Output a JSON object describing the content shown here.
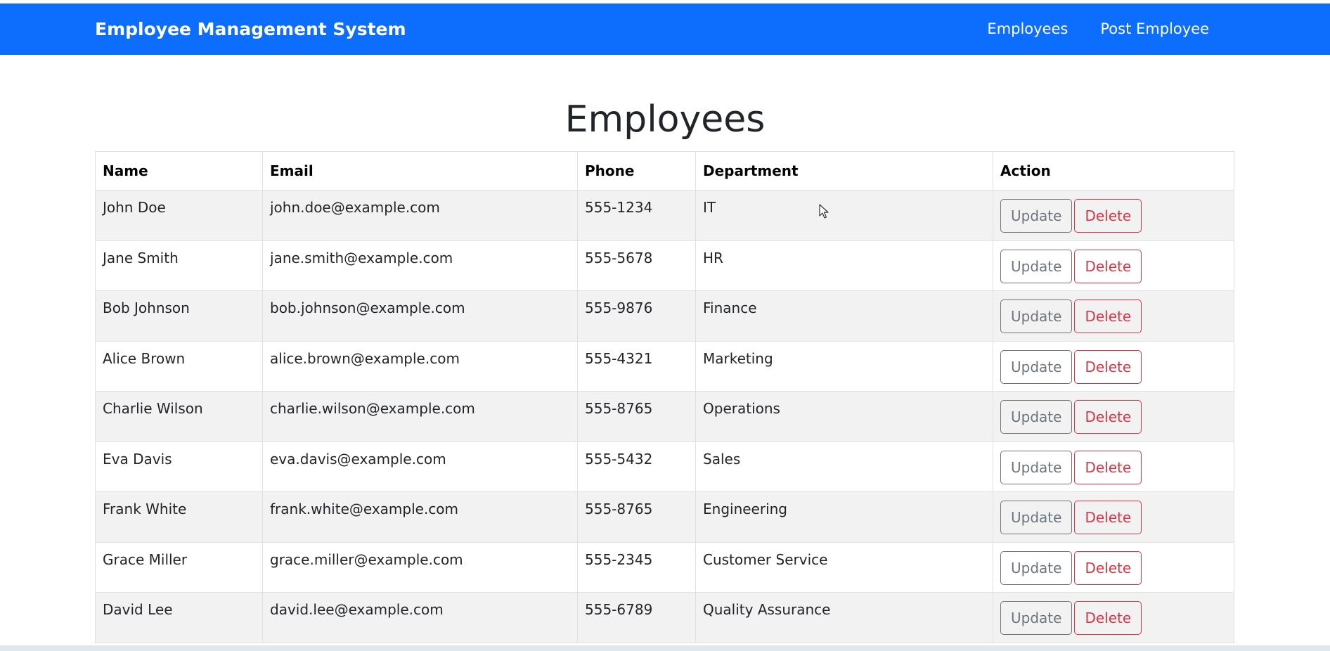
{
  "navbar": {
    "brand": "Employee Management System",
    "links": [
      "Employees",
      "Post Employee"
    ]
  },
  "page": {
    "title": "Employees"
  },
  "table": {
    "headers": [
      "Name",
      "Email",
      "Phone",
      "Department",
      "Action"
    ],
    "rows": [
      {
        "name": "John Doe",
        "email": "john.doe@example.com",
        "phone": "555-1234",
        "department": "IT"
      },
      {
        "name": "Jane Smith",
        "email": "jane.smith@example.com",
        "phone": "555-5678",
        "department": "HR"
      },
      {
        "name": "Bob Johnson",
        "email": "bob.johnson@example.com",
        "phone": "555-9876",
        "department": "Finance"
      },
      {
        "name": "Alice Brown",
        "email": "alice.brown@example.com",
        "phone": "555-4321",
        "department": "Marketing"
      },
      {
        "name": "Charlie Wilson",
        "email": "charlie.wilson@example.com",
        "phone": "555-8765",
        "department": "Operations"
      },
      {
        "name": "Eva Davis",
        "email": "eva.davis@example.com",
        "phone": "555-5432",
        "department": "Sales"
      },
      {
        "name": "Frank White",
        "email": "frank.white@example.com",
        "phone": "555-8765",
        "department": "Engineering"
      },
      {
        "name": "Grace Miller",
        "email": "grace.miller@example.com",
        "phone": "555-2345",
        "department": "Customer Service"
      },
      {
        "name": "David Lee",
        "email": "david.lee@example.com",
        "phone": "555-6789",
        "department": "Quality Assurance"
      }
    ],
    "update_label": "Update",
    "delete_label": "Delete"
  },
  "colors": {
    "navbar_bg": "#0d6efd",
    "update_outline": "#6c757d",
    "delete_outline": "#dc3545",
    "row_stripe": "#f2f2f2"
  },
  "icons": {
    "cursor": "mouse-pointer-icon"
  }
}
